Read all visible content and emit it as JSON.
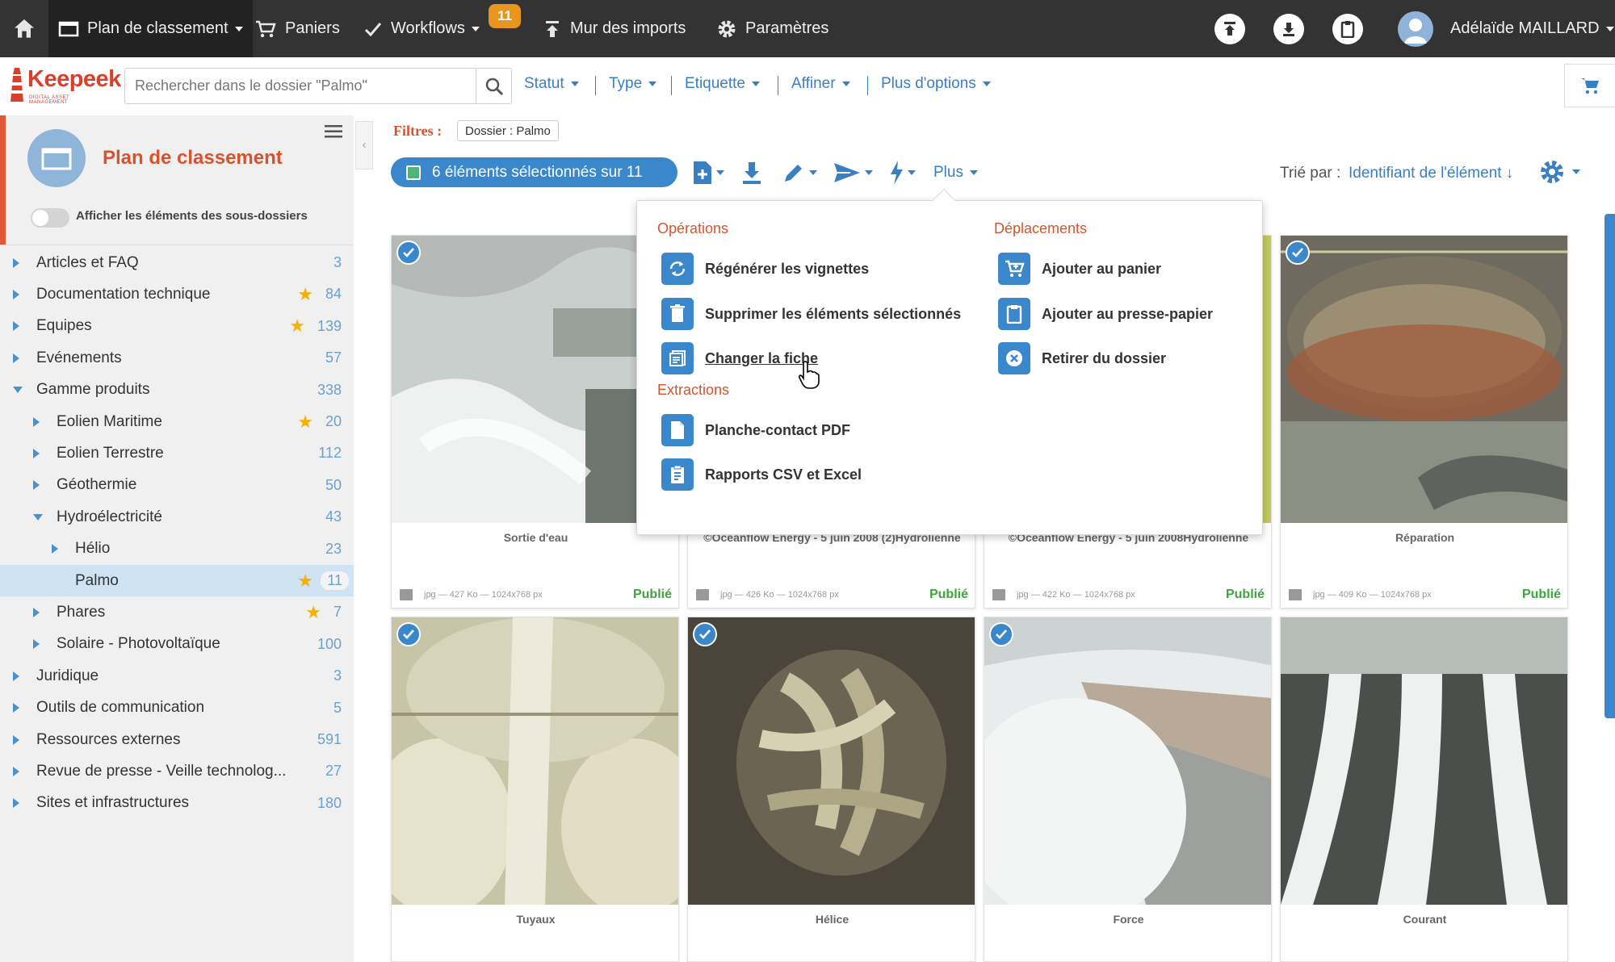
{
  "topbar": {
    "nav": [
      {
        "label": "Plan de classement",
        "icon": "folder-icon"
      },
      {
        "label": "Paniers",
        "icon": "cart-icon"
      },
      {
        "label": "Workflows",
        "icon": "check-icon",
        "badge": "11"
      },
      {
        "label": "Mur des imports",
        "icon": "upload-icon"
      },
      {
        "label": "Paramètres",
        "icon": "gear-icon"
      }
    ],
    "user_name": "Adélaïde MAILLARD"
  },
  "search": {
    "placeholder": "Rechercher dans le dossier \"Palmo\"",
    "filters": [
      "Statut",
      "Type",
      "Etiquette",
      "Affiner",
      "Plus d'options"
    ]
  },
  "logo": {
    "text": "Keepeek",
    "sub": "DIGITAL ASSET MANAGEMENT"
  },
  "sidebar": {
    "title": "Plan de classement",
    "toggle_label": "Afficher les éléments des sous-dossiers",
    "items": [
      {
        "label": "Articles et FAQ",
        "count": "3",
        "level": 0,
        "arrow": "right",
        "star": false
      },
      {
        "label": "Documentation technique",
        "count": "84",
        "level": 0,
        "arrow": "right",
        "star": true
      },
      {
        "label": "Equipes",
        "count": "139",
        "level": 0,
        "arrow": "right",
        "star": true
      },
      {
        "label": "Evénements",
        "count": "57",
        "level": 0,
        "arrow": "right",
        "star": false
      },
      {
        "label": "Gamme produits",
        "count": "338",
        "level": 0,
        "arrow": "down",
        "star": false
      },
      {
        "label": "Eolien Maritime",
        "count": "20",
        "level": 1,
        "arrow": "right",
        "star": true
      },
      {
        "label": "Eolien Terrestre",
        "count": "112",
        "level": 1,
        "arrow": "right",
        "star": false
      },
      {
        "label": "Géothermie",
        "count": "50",
        "level": 1,
        "arrow": "right",
        "star": false
      },
      {
        "label": "Hydroélectricité",
        "count": "43",
        "level": 1,
        "arrow": "down",
        "star": false
      },
      {
        "label": "Hélio",
        "count": "23",
        "level": 2,
        "arrow": "right",
        "star": false
      },
      {
        "label": "Palmo",
        "count": "11",
        "level": 2,
        "arrow": "none",
        "star": true,
        "selected": true
      },
      {
        "label": "Phares",
        "count": "7",
        "level": 1,
        "arrow": "right",
        "star": true
      },
      {
        "label": "Solaire - Photovoltaïque",
        "count": "100",
        "level": 1,
        "arrow": "right",
        "star": false
      },
      {
        "label": "Juridique",
        "count": "3",
        "level": 0,
        "arrow": "right",
        "star": false
      },
      {
        "label": "Outils de communication",
        "count": "5",
        "level": 0,
        "arrow": "right",
        "star": false
      },
      {
        "label": "Ressources externes",
        "count": "591",
        "level": 0,
        "arrow": "right",
        "star": false
      },
      {
        "label": "Revue de presse - Veille technolog...",
        "count": "27",
        "level": 0,
        "arrow": "right",
        "star": false
      },
      {
        "label": "Sites et infrastructures",
        "count": "180",
        "level": 0,
        "arrow": "right",
        "star": false
      }
    ]
  },
  "toolbar": {
    "filtres_label": "Filtres :",
    "filter_chip": "Dossier : Palmo",
    "selection_label": "6 éléments sélectionnés sur 11",
    "plus_label": "Plus",
    "sort_label": "Trié par :",
    "sort_value": "Identifiant de l'élément ↓"
  },
  "dropdown": {
    "operations_title": "Opérations",
    "operations": [
      "Régénérer les vignettes",
      "Supprimer les éléments sélectionnés",
      "Changer la fiche"
    ],
    "extractions_title": "Extractions",
    "extractions": [
      "Planche-contact PDF",
      "Rapports CSV et Excel"
    ],
    "deplacements_title": "Déplacements",
    "deplacements": [
      "Ajouter au panier",
      "Ajouter au presse-papier",
      "Retirer du dossier"
    ]
  },
  "cards": [
    {
      "caption": "Sortie d'eau",
      "meta": "jpg — 427 Ko — 1024x768 px",
      "status": "Publié",
      "checked": true
    },
    {
      "caption": "©Oceanflow Energy - 5 juin 2008 (2)Hydrolienne",
      "meta": "jpg — 426 Ko — 1024x768 px",
      "status": "Publié",
      "checked": false
    },
    {
      "caption": "©Oceanflow Energy - 5 juin 2008Hydrolienne",
      "meta": "jpg — 422 Ko — 1024x768 px",
      "status": "Publié",
      "checked": false
    },
    {
      "caption": "Réparation",
      "meta": "jpg — 409 Ko — 1024x768 px",
      "status": "Publié",
      "checked": true
    },
    {
      "caption": "Tuyaux",
      "checked": true
    },
    {
      "caption": "Hélice",
      "checked": true
    },
    {
      "caption": "Force",
      "checked": true
    },
    {
      "caption": "Courant",
      "checked": false
    }
  ],
  "colors": {
    "topbar": "#333333",
    "accent_blue": "#3a87cc",
    "brand_orange": "#d9522e",
    "published_green": "#3fa33f",
    "badge_orange": "#e8961e"
  }
}
